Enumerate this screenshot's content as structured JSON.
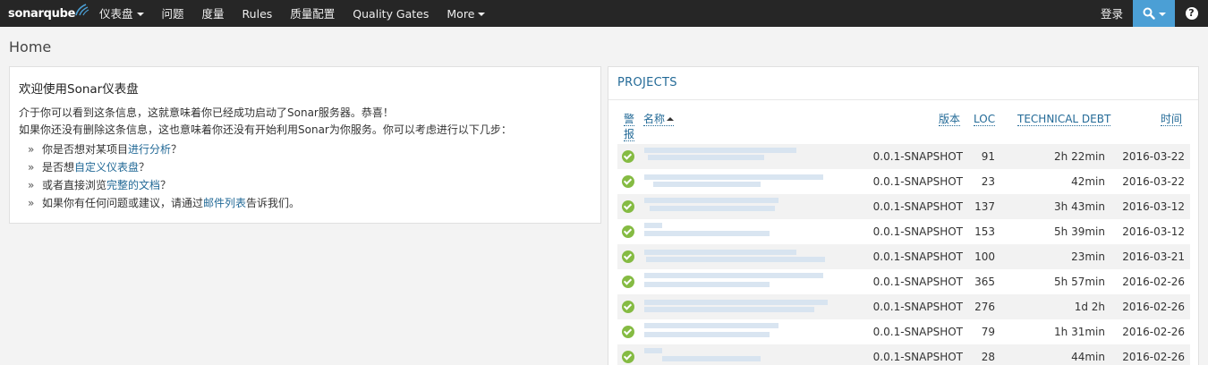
{
  "nav": {
    "logo": "sonarqube",
    "items": [
      {
        "label": "仪表盘",
        "dropdown": true,
        "name": "nav-dashboards"
      },
      {
        "label": "问题",
        "dropdown": false,
        "name": "nav-issues"
      },
      {
        "label": "度量",
        "dropdown": false,
        "name": "nav-measures"
      },
      {
        "label": "Rules",
        "dropdown": false,
        "name": "nav-rules"
      },
      {
        "label": "质量配置",
        "dropdown": false,
        "name": "nav-quality-profiles"
      },
      {
        "label": "Quality Gates",
        "dropdown": false,
        "name": "nav-quality-gates"
      },
      {
        "label": "More",
        "dropdown": true,
        "name": "nav-more"
      }
    ],
    "login": "登录",
    "help": "?"
  },
  "page": {
    "title": "Home"
  },
  "welcome": {
    "title": "欢迎使用Sonar仪表盘",
    "line1": "介于你可以看到这条信息，这就意味着你已经成功启动了Sonar服务器。恭喜！",
    "line2": "如果你还没有删除这条信息，这也意味着你还没有开始利用Sonar为你服务。你可以考虑进行以下几步：",
    "bullet": "»",
    "items": [
      {
        "pre": "你是否想对某项目",
        "link": "进行分析",
        "post": "？"
      },
      {
        "pre": "是否想",
        "link": "自定义仪表盘",
        "post": "？"
      },
      {
        "pre": "或者直接浏览",
        "link": "完整的文档",
        "post": "？"
      },
      {
        "pre": "如果你有任何问题或建议，请通过",
        "link": "邮件列表",
        "post": "告诉我们。"
      }
    ]
  },
  "projects": {
    "title": "PROJECTS",
    "columns": {
      "alert_1": "警",
      "alert_2": "报",
      "name": "名称",
      "version": "版本",
      "loc": "LOC",
      "debt": "TECHNICAL DEBT",
      "date": "时间"
    },
    "status_color": "#85bb43",
    "rows": [
      {
        "version": "0.0.1-SNAPSHOT",
        "loc": "91",
        "debt": "2h 22min",
        "date": "2016-03-22"
      },
      {
        "version": "0.0.1-SNAPSHOT",
        "loc": "23",
        "debt": "42min",
        "date": "2016-03-22"
      },
      {
        "version": "0.0.1-SNAPSHOT",
        "loc": "137",
        "debt": "3h 43min",
        "date": "2016-03-12"
      },
      {
        "version": "0.0.1-SNAPSHOT",
        "loc": "153",
        "debt": "5h 39min",
        "date": "2016-03-12"
      },
      {
        "version": "0.0.1-SNAPSHOT",
        "loc": "100",
        "debt": "23min",
        "date": "2016-03-21"
      },
      {
        "version": "0.0.1-SNAPSHOT",
        "loc": "365",
        "debt": "5h 57min",
        "date": "2016-02-26"
      },
      {
        "version": "0.0.1-SNAPSHOT",
        "loc": "276",
        "debt": "1d 2h",
        "date": "2016-02-26"
      },
      {
        "version": "0.0.1-SNAPSHOT",
        "loc": "79",
        "debt": "1h 31min",
        "date": "2016-02-26"
      },
      {
        "version": "0.0.1-SNAPSHOT",
        "loc": "28",
        "debt": "44min",
        "date": "2016-02-26"
      }
    ]
  }
}
